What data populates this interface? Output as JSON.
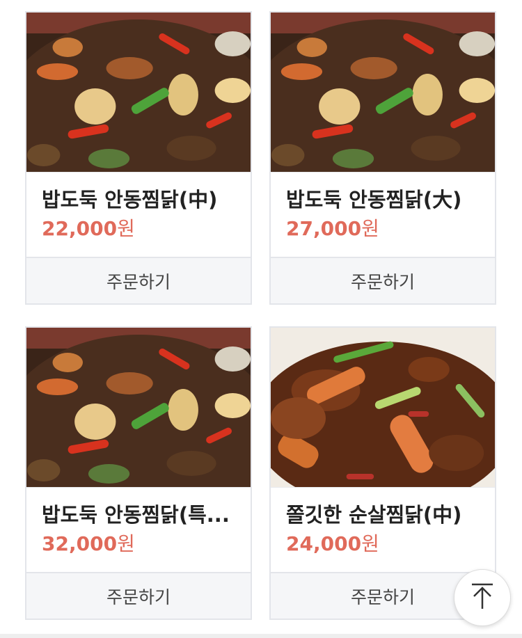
{
  "products": [
    {
      "name": "밥도둑 안동찜닭(中)",
      "price_number": "22,000",
      "price_unit": "원",
      "order_label": "주문하기",
      "image": "andong-jjimdak-photo"
    },
    {
      "name": "밥도둑 안동찜닭(大)",
      "price_number": "27,000",
      "price_unit": "원",
      "order_label": "주문하기",
      "image": "andong-jjimdak-photo"
    },
    {
      "name": "밥도둑 안동찜닭(특...",
      "price_number": "32,000",
      "price_unit": "원",
      "order_label": "주문하기",
      "image": "andong-jjimdak-photo"
    },
    {
      "name": "쫄깃한 순살찜닭(中)",
      "price_number": "24,000",
      "price_unit": "원",
      "order_label": "주문하기",
      "image": "boneless-jjimdak-photo"
    }
  ],
  "scroll_top": {
    "icon": "arrow-up-to-top-icon"
  },
  "colors": {
    "price": "#e06a5a",
    "button_bg": "#f5f6f8",
    "border": "#e3e5ea"
  }
}
